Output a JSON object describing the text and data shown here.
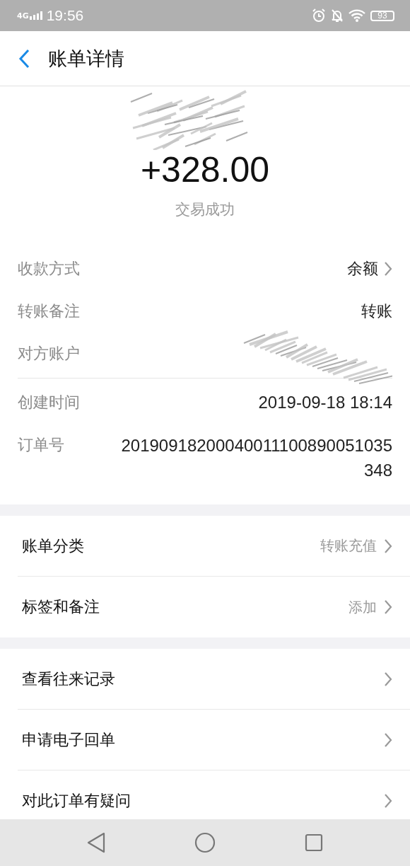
{
  "status_bar": {
    "network": "4G",
    "time": "19:56",
    "battery": "93"
  },
  "header": {
    "title": "账单详情"
  },
  "summary": {
    "amount": "+328.00",
    "status": "交易成功"
  },
  "detail_groups": [
    [
      {
        "kind": "text",
        "label": "收款方式",
        "value": "余额",
        "chevron": true
      },
      {
        "kind": "text",
        "label": "转账备注",
        "value": "转账",
        "chevron": false
      },
      {
        "kind": "redacted",
        "label": "对方账户"
      }
    ],
    [
      {
        "kind": "text",
        "label": "创建时间",
        "value": "2019-09-18 18:14",
        "chevron": false
      },
      {
        "kind": "wrap",
        "label": "订单号",
        "value": "20190918200040011100890051035348"
      }
    ]
  ],
  "sections": [
    {
      "rows": [
        {
          "label": "账单分类",
          "value": "转账充值"
        },
        {
          "label": "标签和备注",
          "value": "添加"
        }
      ]
    },
    {
      "rows": [
        {
          "label": "查看往来记录"
        },
        {
          "label": "申请电子回单"
        },
        {
          "label": "对此订单有疑问"
        }
      ]
    }
  ]
}
